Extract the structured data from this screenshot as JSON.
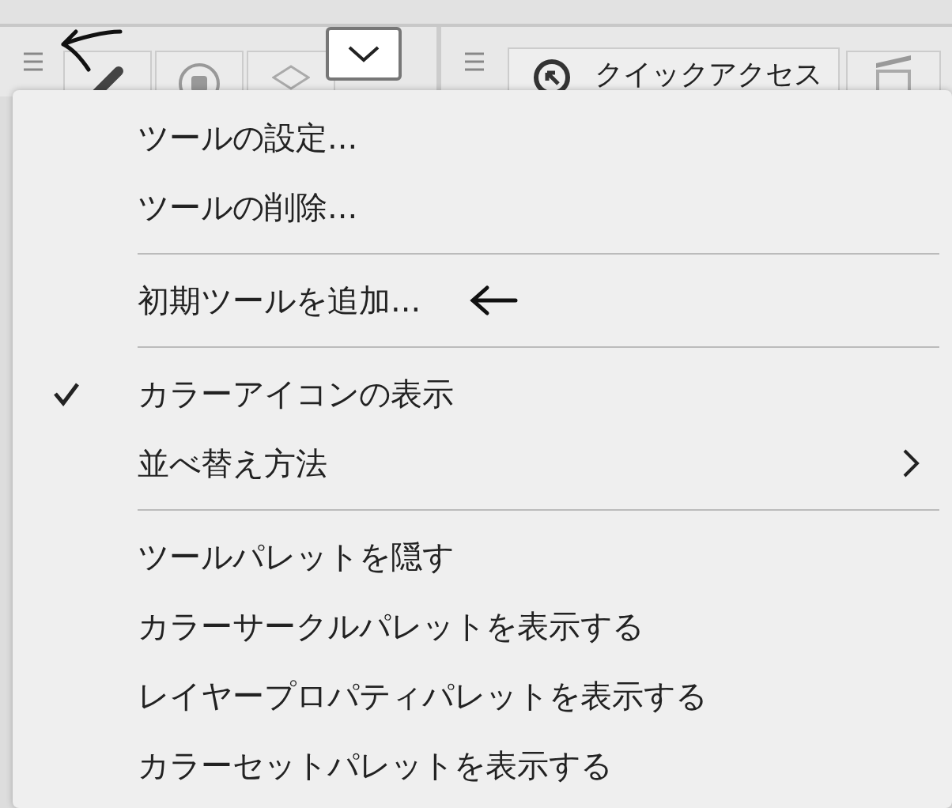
{
  "toolbar": {
    "quick_access_tab": "クイックアクセス"
  },
  "menu": {
    "groups": [
      [
        {
          "label": "ツールの設定...",
          "checked": false,
          "submenu": false
        },
        {
          "label": "ツールの削除...",
          "checked": false,
          "submenu": false
        }
      ],
      [
        {
          "label": "初期ツールを追加...",
          "checked": false,
          "submenu": false
        }
      ],
      [
        {
          "label": "カラーアイコンの表示",
          "checked": true,
          "submenu": false
        },
        {
          "label": "並べ替え方法",
          "checked": false,
          "submenu": true
        }
      ],
      [
        {
          "label": "ツールパレットを隠す",
          "checked": false,
          "submenu": false
        },
        {
          "label": "カラーサークルパレットを表示する",
          "checked": false,
          "submenu": false
        },
        {
          "label": "レイヤープロパティパレットを表示する",
          "checked": false,
          "submenu": false
        },
        {
          "label": "カラーセットパレットを表示する",
          "checked": false,
          "submenu": false
        }
      ]
    ]
  }
}
